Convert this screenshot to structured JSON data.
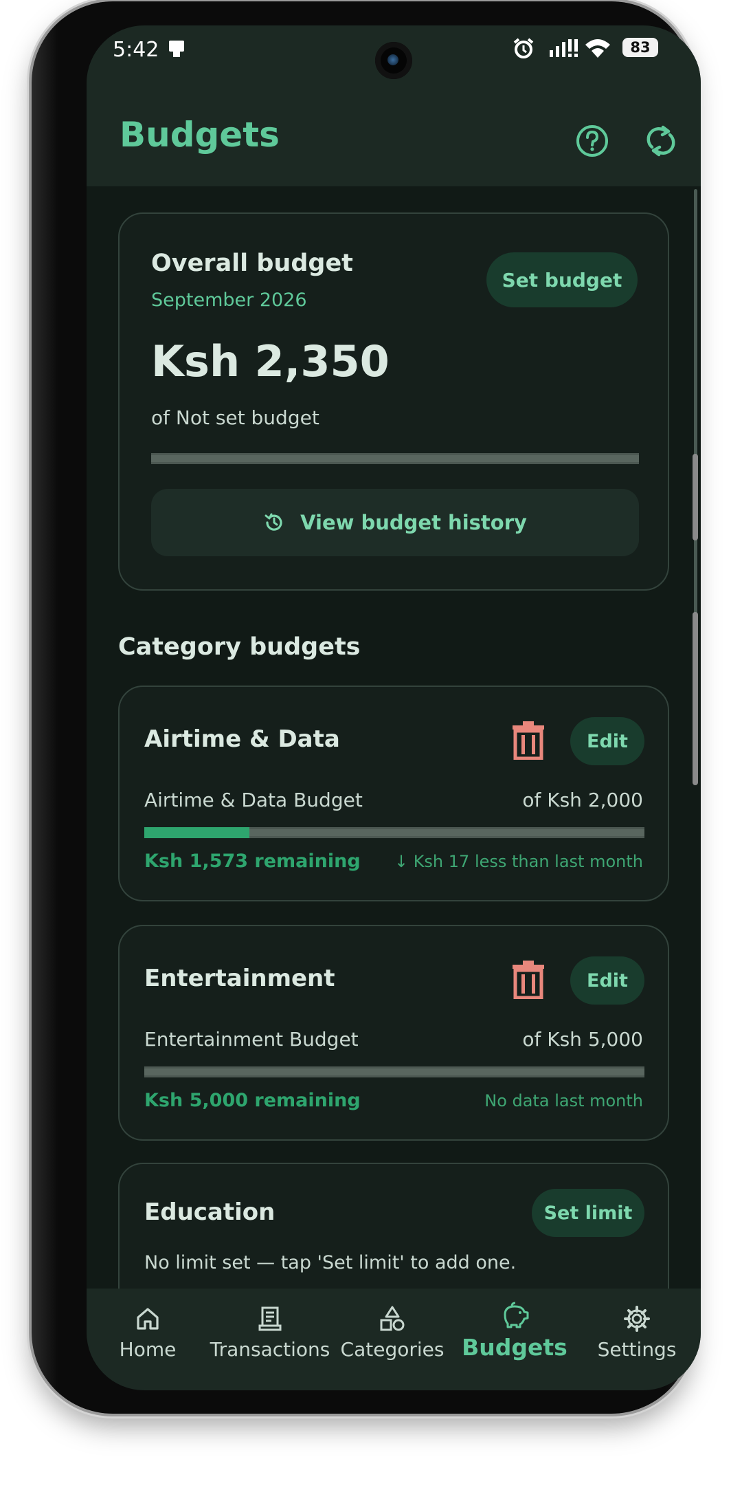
{
  "status": {
    "time": "5:42",
    "battery": "83"
  },
  "header": {
    "title": "Budgets"
  },
  "overall": {
    "title": "Overall budget",
    "month": "September 2026",
    "set_budget_label": "Set budget",
    "amount": "Ksh 2,350",
    "of_text": "of Not set budget",
    "progress": 0,
    "history_label": "View budget history"
  },
  "category_section": {
    "title": "Category budgets"
  },
  "categories": [
    {
      "name": "Airtime & Data",
      "edit_label": "Edit",
      "budget_name": "Airtime & Data Budget",
      "of_amount": "of Ksh 2,000",
      "progress": 0.21,
      "remaining": "Ksh 1,573 remaining",
      "comparison": "↓ Ksh 17 less than last month"
    },
    {
      "name": "Entertainment",
      "edit_label": "Edit",
      "budget_name": "Entertainment Budget",
      "of_amount": "of Ksh 5,000",
      "progress": 0,
      "remaining": "Ksh 5,000 remaining",
      "comparison": "No data last month"
    },
    {
      "name": "Education",
      "set_limit_label": "Set limit",
      "no_limit_text": "No limit set — tap 'Set limit' to add one."
    }
  ],
  "nav": {
    "items": [
      {
        "label": "Home",
        "icon": "home-icon"
      },
      {
        "label": "Transactions",
        "icon": "receipt-icon"
      },
      {
        "label": "Categories",
        "icon": "shapes-icon"
      },
      {
        "label": "Budgets",
        "icon": "piggy-bank-icon"
      },
      {
        "label": "Settings",
        "icon": "gear-icon"
      }
    ],
    "active_index": 3
  },
  "colors": {
    "accent": "#5fc99a",
    "progress": "#2ea56e",
    "delete": "#e8877c",
    "background": "#111a16",
    "surface": "#1c2923"
  }
}
